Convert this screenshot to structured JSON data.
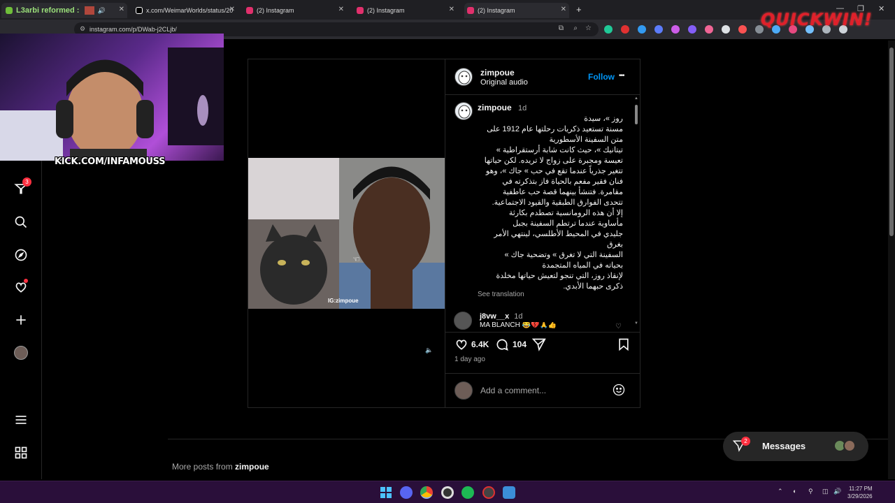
{
  "browser": {
    "tabs": [
      {
        "label": "L3arbi reformed :",
        "favicon_color": "#6fbf3a"
      },
      {
        "label": "x.com/WeimarWorlds/status/20",
        "favicon_color": "#ffffff"
      },
      {
        "label": "(2) Instagram",
        "favicon_color": "#e1306c"
      },
      {
        "label": "(2) Instagram",
        "favicon_color": "#e1306c"
      },
      {
        "label": "(2) Instagram",
        "favicon_color": "#e1306c"
      }
    ],
    "new_tab_symbol": "+",
    "url": "instagram.com/p/DWab-j2CLjb/"
  },
  "overlay": {
    "kick_text": "KICK.COM/INFAMOUSS",
    "quickwin_logo": "QUICKWIN!"
  },
  "sidebar": {
    "notification_count": "3",
    "icons": [
      "reels-icon",
      "search-icon",
      "explore-icon",
      "heart-icon",
      "create-icon",
      "profile-icon",
      "menu-icon",
      "apps-icon"
    ]
  },
  "post": {
    "username": "zimpoue",
    "audio": "Original audio",
    "follow_label": "Follow",
    "more_symbol": "•••",
    "video_watermark": "IG:zimpoue",
    "caption": {
      "username": "zimpoue",
      "time": "1d",
      "lines": [
        "روز »، سيدة",
        "مسنة تستعيد ذكريات رحلتها عام 1912 على",
        "متن السفينة الأسطورية",
        "تيتانيك »، حيث كانت شابة أرستقراطية »",
        "تعيسة ومجبرة على زواج لا تريده. لكن حياتها",
        "تتغير جذرياً عندما تقع في حب » جاك »، وهو",
        "فنان فقير مفعم بالحياة فاز بتذكرته في",
        "مقامرة. فتنشأ بينهما قصة حب عاطفية",
        "تتحدى الفوارق الطبقية والقيود الاجتماعية.",
        "إلا أن هذه الرومانسية تصطدم بكارثة",
        "مأساوية عندما ترتطم السفينة بجبل",
        "جليدي في المحيط الأطلسي، لينتهي الأمر",
        "بغرق",
        "السفينة التي لا تغرق » وتضحية جاك »",
        "بحياته في المياه المتجمدة",
        "لإنقاذ روز، التي تنجو لتعيش حياتها مخلدة",
        "ذكرى حبهما الأبدي."
      ],
      "see_translation": "See translation"
    },
    "comment": {
      "username": "j8vw__x",
      "time": "1d",
      "text": "MA BLANCH 😂💔🙏👍"
    },
    "likes": "6.4K",
    "comments_count": "104",
    "posted": "1 day ago",
    "add_comment_placeholder": "Add a comment..."
  },
  "more_posts": {
    "prefix": "More posts from",
    "username": "zimpoue"
  },
  "messages": {
    "label": "Messages",
    "badge": "2"
  },
  "taskbar": {
    "time": "11:27 PM",
    "date": "3/29/2026"
  },
  "colors": {
    "accent_blue": "#0095f6",
    "background": "#000000",
    "badge_red": "#ff3040",
    "taskbar": "#2a0f3a"
  }
}
